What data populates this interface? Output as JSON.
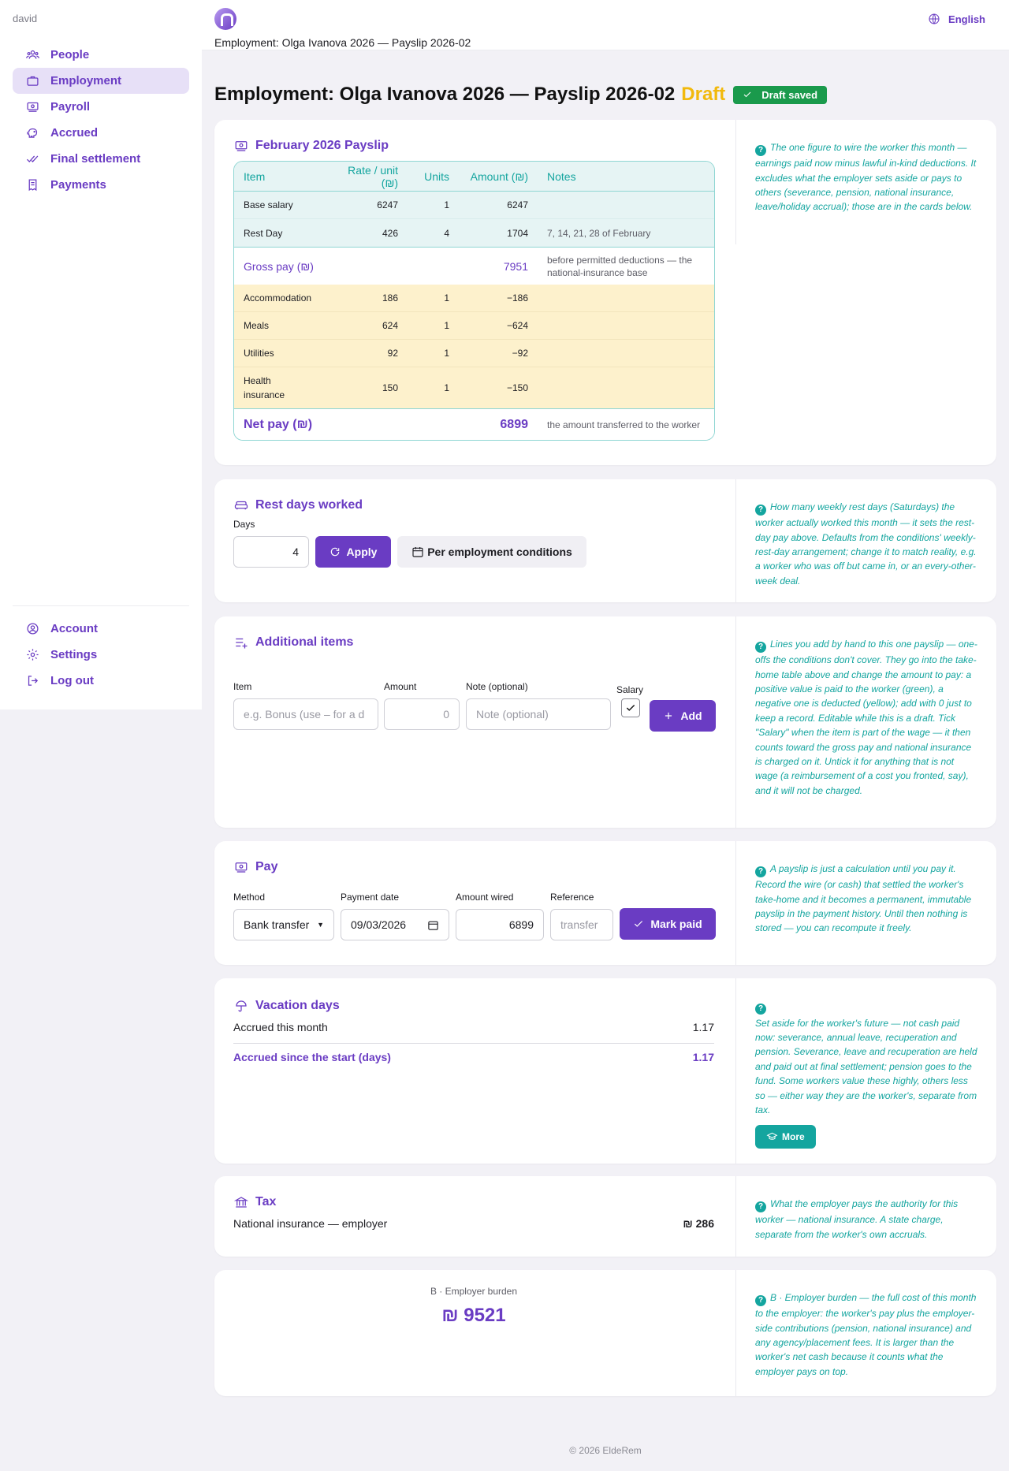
{
  "user": {
    "name": "david"
  },
  "nav": {
    "main": [
      {
        "label": "People",
        "icon": "people-icon"
      },
      {
        "label": "Employment",
        "icon": "briefcase-icon"
      },
      {
        "label": "Payroll",
        "icon": "money-icon"
      },
      {
        "label": "Accrued",
        "icon": "piggy-bank-icon"
      },
      {
        "label": "Final settlement",
        "icon": "double-check-icon"
      },
      {
        "label": "Payments",
        "icon": "receipt-icon"
      }
    ],
    "bottom": [
      {
        "label": "Account",
        "icon": "user-circle-icon"
      },
      {
        "label": "Settings",
        "icon": "gear-icon"
      },
      {
        "label": "Log out",
        "icon": "logout-icon"
      }
    ]
  },
  "header": {
    "breadcrumb": "Employment: Olga Ivanova 2026 — Payslip 2026-02",
    "language": "English"
  },
  "title": {
    "text": "Employment: Olga Ivanova 2026 — Payslip 2026-02",
    "status": "Draft",
    "saved_badge": "Draft saved"
  },
  "payslip": {
    "title": "February 2026 Payslip",
    "columns": [
      "Item",
      "Rate / unit (₪)",
      "Units",
      "Amount (₪)",
      "Notes"
    ],
    "earnings": [
      {
        "item": "Base salary",
        "rate": "6247",
        "units": "1",
        "amount": "6247",
        "note": ""
      },
      {
        "item": "Rest Day",
        "rate": "426",
        "units": "4",
        "amount": "1704",
        "note": "7, 14, 21, 28 of February"
      }
    ],
    "gross": {
      "label": "Gross pay (₪)",
      "amount": "7951",
      "note": "before permitted deductions — the national-insurance base"
    },
    "deductions": [
      {
        "item": "Accommodation",
        "rate": "186",
        "units": "1",
        "amount": "−186",
        "note": ""
      },
      {
        "item": "Meals",
        "rate": "624",
        "units": "1",
        "amount": "−624",
        "note": ""
      },
      {
        "item": "Utilities",
        "rate": "92",
        "units": "1",
        "amount": "−92",
        "note": ""
      },
      {
        "item": "Health insurance",
        "rate": "150",
        "units": "1",
        "amount": "−150",
        "note": ""
      }
    ],
    "net": {
      "label": "Net pay (₪)",
      "amount": "6899",
      "note": "the amount transferred to the worker"
    },
    "help": "The one figure to wire the worker this month — earnings paid now minus lawful in-kind deductions. It excludes what the employer sets aside or pays to others (severance, pension, national insurance, leave/holiday accrual); those are in the cards below."
  },
  "rest_days": {
    "title": "Rest days worked",
    "days_label": "Days",
    "days_value": "4",
    "apply_label": "Apply",
    "conditions_label": "Per employment conditions",
    "help": "How many weekly rest days (Saturdays) the worker actually worked this month — it sets the rest-day pay above. Defaults from the conditions' weekly-rest-day arrangement; change it to match reality, e.g. a worker who was off but came in, or an every-other-week deal."
  },
  "additional": {
    "title": "Additional items",
    "item_label": "Item",
    "item_placeholder": "e.g. Bonus (use – for a d",
    "amount_label": "Amount",
    "amount_placeholder": "0",
    "note_label": "Note (optional)",
    "note_placeholder": "Note (optional)",
    "salary_label": "Salary",
    "add_label": "Add",
    "help": "Lines you add by hand to this one payslip — one-offs the conditions don't cover. They go into the take-home table above and change the amount to pay: a positive value is paid to the worker (green), a negative one is deducted (yellow); add with 0 just to keep a record. Editable while this is a draft. Tick \"Salary\" when the item is part of the wage — it then counts toward the gross pay and national insurance is charged on it. Untick it for anything that is not wage (a reimbursement of a cost you fronted, say), and it will not be charged."
  },
  "pay": {
    "title": "Pay",
    "method_label": "Method",
    "method_value": "Bank transfer",
    "date_label": "Payment date",
    "date_value": "09/03/2026",
    "wired_label": "Amount wired",
    "wired_value": "6899",
    "ref_label": "Reference",
    "ref_placeholder": "transfer",
    "mark_paid_label": "Mark paid",
    "help": "A payslip is just a calculation until you pay it. Record the wire (or cash) that settled the worker's take-home and it becomes a permanent, immutable payslip in the payment history. Until then nothing is stored — you can recompute it freely."
  },
  "vacation": {
    "title": "Vacation days",
    "accrued_month_label": "Accrued this month",
    "accrued_month_value": "1.17",
    "accrued_total_label": "Accrued since the start (days)",
    "accrued_total_value": "1.17",
    "help": "Set aside for the worker's future — not cash paid now: severance, annual leave, recuperation and pension. Severance, leave and recuperation are held and paid out at final settlement; pension goes to the fund. Some workers value these highly, others less so — either way they are the worker's, separate from tax.",
    "more_label": "More"
  },
  "tax": {
    "title": "Tax",
    "ni_label": "National insurance — employer",
    "ni_value": "₪ 286",
    "help": "What the employer pays the authority for this worker — national insurance. A state charge, separate from the worker's own accruals."
  },
  "burden": {
    "label": "B · Employer burden",
    "value": "₪ 9521",
    "help": "B · Employer burden — the full cost of this month to the employer: the worker's pay plus the employer-side contributions (pension, national insurance) and any agency/placement fees. It is larger than the worker's net cash because it counts what the employer pays on top."
  },
  "footer": {
    "text": "© 2026 EldeRem"
  },
  "colors": {
    "accent": "#6a3cc3",
    "help": "#14a59f",
    "draft": "#f2b90c",
    "saved": "#1a9a4c",
    "earning_bg": "#e6f4f4",
    "deduction_bg": "#fdf1cc"
  }
}
